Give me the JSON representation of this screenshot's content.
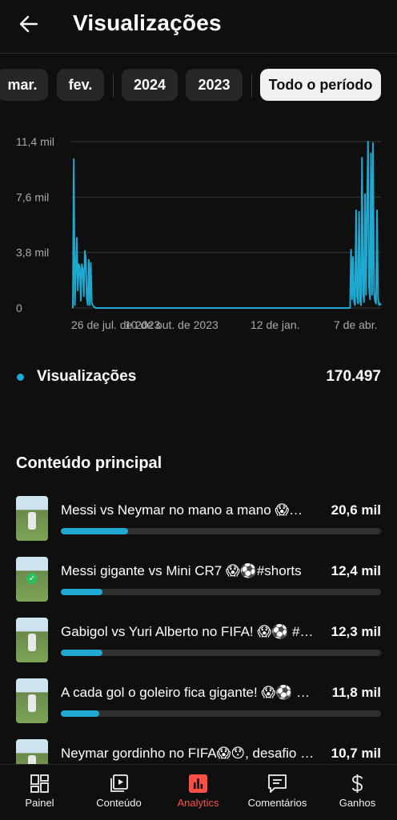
{
  "header": {
    "title": "Visualizações"
  },
  "filters": {
    "chips": [
      {
        "label": "mar.",
        "active": false
      },
      {
        "label": "fev.",
        "active": false
      },
      {
        "label": "2024",
        "active": false
      },
      {
        "label": "2023",
        "active": false
      },
      {
        "label": "Todo o período",
        "active": true
      }
    ]
  },
  "summary": {
    "label": "Visualizações",
    "value": "170.497",
    "color": "#1fa8d0"
  },
  "chart_data": {
    "type": "line",
    "y_ticks": [
      "11,4 mil",
      "7,6 mil",
      "3,8 mil",
      "0"
    ],
    "y_tick_values": [
      11400,
      7600,
      3800,
      0
    ],
    "ylim": [
      0,
      11400
    ],
    "x_ticks": [
      "26 de jul. de 2023",
      "10 de out. de 2023",
      "12 de jan.",
      "7 de abr."
    ],
    "grid": true,
    "color": "#1fa8d0",
    "series": [
      {
        "values": [
          0,
          10200,
          200,
          2400,
          4800,
          1200,
          3000,
          2800,
          500,
          3000,
          2600,
          800,
          3900,
          3400,
          700,
          200,
          3300,
          200,
          3100,
          300,
          200,
          100,
          50,
          0,
          0,
          0,
          0,
          0,
          0,
          0,
          0,
          0,
          0,
          0,
          0,
          0,
          0,
          0,
          0,
          0,
          0,
          0,
          0,
          0,
          0,
          0,
          0,
          0,
          0,
          0,
          0,
          0,
          0,
          0,
          0,
          0,
          0,
          0,
          0,
          0,
          0,
          0,
          0,
          0,
          0,
          0,
          0,
          0,
          0,
          0,
          0,
          0,
          0,
          0,
          0,
          0,
          0,
          0,
          0,
          0,
          0,
          0,
          0,
          0,
          0,
          0,
          0,
          0,
          0,
          0,
          0,
          0,
          0,
          0,
          0,
          0,
          0,
          0,
          0,
          0,
          0,
          0,
          0,
          0,
          0,
          0,
          0,
          0,
          0,
          0,
          0,
          0,
          0,
          0,
          0,
          0,
          0,
          0,
          0,
          0,
          0,
          0,
          0,
          0,
          0,
          0,
          0,
          0,
          0,
          0,
          0,
          0,
          0,
          0,
          0,
          0,
          0,
          0,
          0,
          0,
          0,
          0,
          0,
          0,
          0,
          0,
          0,
          0,
          0,
          0,
          0,
          0,
          0,
          0,
          0,
          0,
          0,
          0,
          0,
          0,
          0,
          0,
          0,
          0,
          0,
          0,
          0,
          0,
          0,
          0,
          0,
          0,
          0,
          0,
          0,
          0,
          0,
          0,
          0,
          0,
          0,
          0,
          0,
          0,
          0,
          0,
          0,
          0,
          0,
          0,
          0,
          0,
          0,
          0,
          0,
          0,
          0,
          0,
          0,
          0,
          0,
          0,
          0,
          0,
          0,
          0,
          0,
          0,
          0,
          0,
          0,
          0,
          0,
          0,
          0,
          0,
          0,
          0,
          0,
          0,
          0,
          0,
          0,
          0,
          0,
          0,
          0,
          0,
          0,
          0,
          0,
          0,
          0,
          0,
          0,
          0,
          0,
          0,
          0,
          0,
          0,
          0,
          0,
          0,
          0,
          0,
          0,
          0,
          0,
          0,
          0,
          0,
          0,
          0,
          0,
          0,
          0,
          0,
          0,
          0,
          0,
          0,
          0,
          0,
          0,
          0,
          0,
          0,
          0,
          0,
          0,
          0,
          0,
          0,
          0,
          0,
          0,
          0,
          0,
          4000,
          600,
          3500,
          400,
          200,
          6700,
          800,
          300,
          6600,
          500,
          200,
          10300,
          1000,
          400,
          7800,
          900,
          6800,
          11400,
          1500,
          600,
          10600,
          900,
          11300,
          1200,
          500,
          300,
          6700,
          700,
          200,
          300,
          200
        ]
      }
    ]
  },
  "top_content": {
    "title": "Conteúdo principal",
    "items": [
      {
        "title": "Messi vs Neymar no mano a mano 😱⚽ #shorts",
        "value": "20,6 mil",
        "fraction": 0.21
      },
      {
        "title": "Messi gigante vs Mini CR7 😱⚽#shorts",
        "value": "12,4 mil",
        "fraction": 0.13
      },
      {
        "title": "Gabigol vs Yuri Alberto no FIFA! 😱⚽ #shorts",
        "value": "12,3 mil",
        "fraction": 0.13
      },
      {
        "title": "A cada gol o goleiro fica gigante! 😱⚽ #shorts",
        "value": "11,8 mil",
        "fraction": 0.12
      },
      {
        "title": "Neymar gordinho no FIFA😱😯, desafio #shorts",
        "value": "10,7 mil",
        "fraction": 0.11
      }
    ]
  },
  "bottom_nav": {
    "items": [
      {
        "label": "Painel",
        "icon": "dashboard-icon",
        "active": false
      },
      {
        "label": "Conteúdo",
        "icon": "content-icon",
        "active": false
      },
      {
        "label": "Analytics",
        "icon": "analytics-icon",
        "active": true
      },
      {
        "label": "Comentários",
        "icon": "comments-icon",
        "active": false
      },
      {
        "label": "Ganhos",
        "icon": "earnings-icon",
        "active": false
      }
    ],
    "active_color": "#ff4e45"
  }
}
